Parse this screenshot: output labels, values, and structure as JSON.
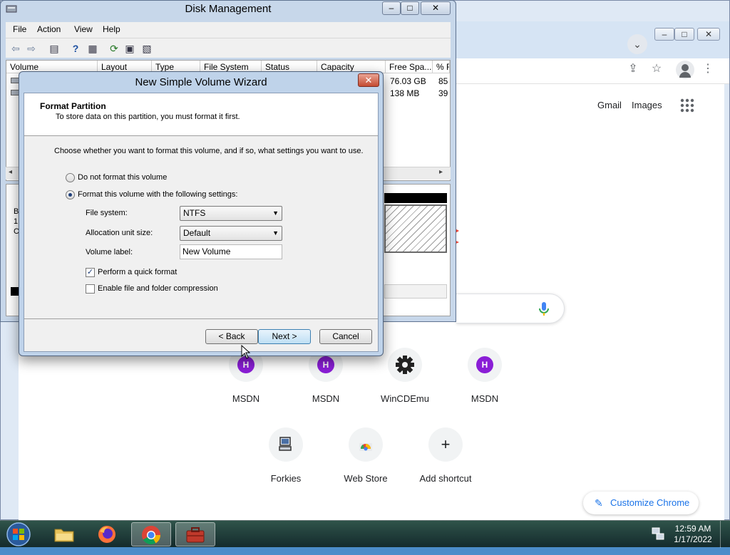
{
  "chrome": {
    "links": [
      "Gmail",
      "Images"
    ],
    "shortcuts_row1": [
      {
        "label": "MSDN",
        "icon": "H"
      },
      {
        "label": "MSDN",
        "icon": "H"
      },
      {
        "label": "WinCDEmu",
        "icon": "gear-icon"
      },
      {
        "label": "MSDN",
        "icon": "H"
      }
    ],
    "shortcuts_row2": [
      {
        "label": "Forkies",
        "icon": "computer-icon"
      },
      {
        "label": "Web Store",
        "icon": "web-store-icon"
      },
      {
        "label": "Add shortcut",
        "icon": "plus-icon"
      }
    ],
    "customize_label": "Customize Chrome"
  },
  "disk_management": {
    "title": "Disk Management",
    "menu": [
      "File",
      "Action",
      "View",
      "Help"
    ],
    "columns": [
      "Volume",
      "Layout",
      "Type",
      "File System",
      "Status",
      "Capacity",
      "Free Spa...",
      "% F"
    ],
    "rows": [
      {
        "free_space": "76.03 GB",
        "percent_free": "85"
      },
      {
        "free_space": "138 MB",
        "percent_free": "39"
      }
    ]
  },
  "wizard": {
    "title": "New Simple Volume Wizard",
    "header_title": "Format Partition",
    "header_subtitle": "To store data on this partition, you must format it first.",
    "instruction": "Choose whether you want to format this volume, and if so, what settings you want to use.",
    "option_no_format": "Do not format this volume",
    "option_format": "Format this volume with the following settings:",
    "file_system_label": "File system:",
    "file_system_value": "NTFS",
    "allocation_label": "Allocation unit size:",
    "allocation_value": "Default",
    "volume_label_label": "Volume label:",
    "volume_label_value": "New Volume",
    "quick_format_label": "Perform a quick format",
    "quick_format_checked": true,
    "compression_label": "Enable file and folder compression",
    "compression_checked": false,
    "back_label": "< Back",
    "next_label": "Next >",
    "cancel_label": "Cancel"
  },
  "taskbar": {
    "time": "12:59 AM",
    "date": "1/17/2022"
  }
}
